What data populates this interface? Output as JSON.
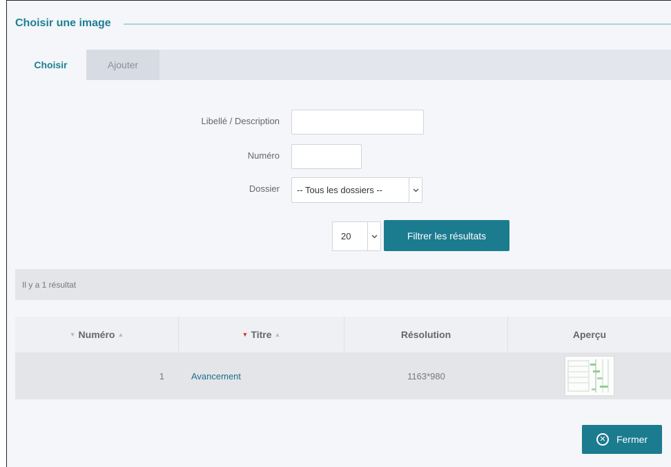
{
  "dialog": {
    "title": "Choisir une image"
  },
  "tabs": [
    {
      "label": "Choisir",
      "active": true
    },
    {
      "label": "Ajouter",
      "active": false
    }
  ],
  "filters": {
    "label_description": "Libellé / Description",
    "label_numero": "Numéro",
    "label_dossier": "Dossier",
    "description_value": "",
    "numero_value": "",
    "dossier_selected": "-- Tous les dossiers --",
    "page_size_selected": "20",
    "filter_button": "Filtrer les résultats"
  },
  "results": {
    "count_text": "Il y a 1 résultat"
  },
  "table": {
    "headers": [
      "Numéro",
      "Titre",
      "Résolution",
      "Aperçu"
    ],
    "rows": [
      {
        "numero": "1",
        "titre": "Avancement",
        "resolution": "1163*980"
      }
    ]
  },
  "footer": {
    "close_button": "Fermer"
  },
  "colors": {
    "accent": "#1b7b8f",
    "title": "#1e7f94",
    "sort_active": "#d9362b"
  }
}
